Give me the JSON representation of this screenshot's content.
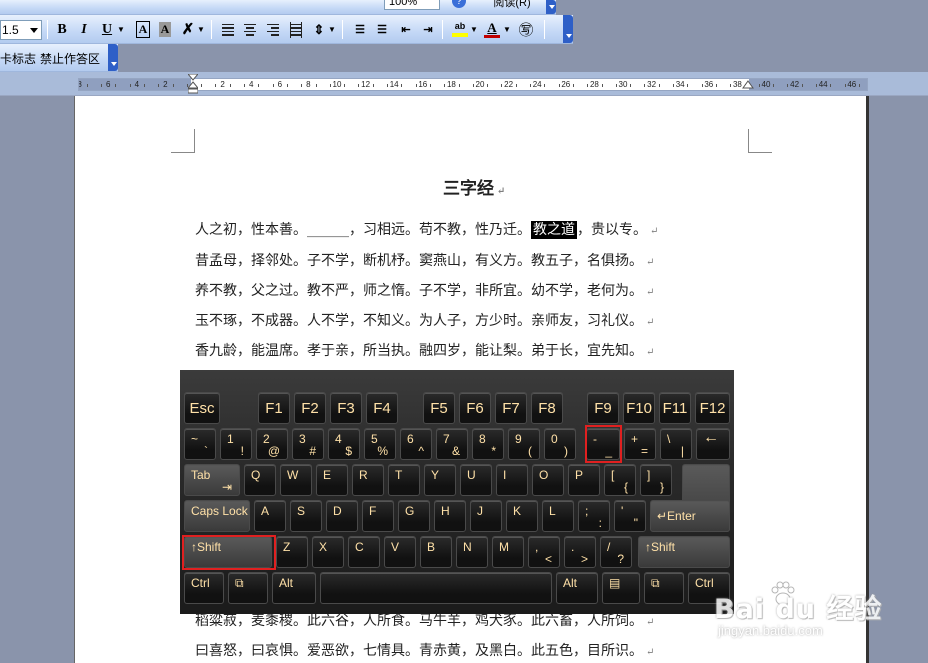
{
  "toolbar_top": {
    "zoom_value": "100%",
    "read_label": "阅读(R)"
  },
  "toolbar_format": {
    "line_spacing_value": "1.5",
    "bold_label": "B",
    "italic_label": "I",
    "underline_label": "U",
    "char_border_label": "A",
    "char_shading_label": "A",
    "font_color_label": "A",
    "highlight_label": "ab"
  },
  "toolbar_small": {
    "item1": "卡标志",
    "item2": "禁止作答区"
  },
  "ruler": {
    "left_numbers": [
      "8",
      "6",
      "4",
      "2"
    ],
    "right_numbers": [
      "2",
      "4",
      "6",
      "8",
      "10",
      "12",
      "14",
      "16",
      "18",
      "20",
      "22",
      "24",
      "26",
      "28",
      "30",
      "32",
      "34",
      "36",
      "38",
      "40",
      "42",
      "44",
      "46",
      "48"
    ]
  },
  "document": {
    "title": "三字经",
    "lines": [
      [
        "人之初，性本善。______，习相远。苟不教，性乃迁。",
        "教之道",
        "，贵以专。"
      ],
      [
        "昔孟母，择邻处。子不学，断机杼。窦燕山，有义方。教五子，名俱扬。"
      ],
      [
        "养不教，父之过。教不严，师之惰。子不学，非所宜。幼不学，老何为。"
      ],
      [
        "玉不琢，不成器。人不学，不知义。为人子，方少时。亲师友，习礼仪。"
      ],
      [
        "香九龄，能温席。孝于亲，所当执。融四岁，能让梨。弟于长，宜先知。"
      ],
      [
        "稻粱菽，麦黍稷。此六谷，人所食。马牛羊，鸡犬豕。此六畜，人所饲。"
      ],
      [
        "曰喜怒，曰哀惧。爱恶欲，七情具。青赤黄，及黑白。此五色，目所识。"
      ]
    ],
    "paragraph_mark": "↵"
  },
  "keyboard": {
    "row_f": [
      "Esc",
      "F1",
      "F2",
      "F3",
      "F4",
      "F5",
      "F6",
      "F7",
      "F8",
      "F9",
      "F10",
      "F11",
      "F12"
    ],
    "row_num": [
      {
        "top": "~",
        "bottom": "`"
      },
      {
        "top": "1",
        "bottom": "!"
      },
      {
        "top": "2",
        "bottom": "@"
      },
      {
        "top": "3",
        "bottom": "#"
      },
      {
        "top": "4",
        "bottom": "$"
      },
      {
        "top": "5",
        "bottom": "%"
      },
      {
        "top": "6",
        "bottom": "^"
      },
      {
        "top": "7",
        "bottom": "&"
      },
      {
        "top": "8",
        "bottom": "*"
      },
      {
        "top": "9",
        "bottom": "("
      },
      {
        "top": "0",
        "bottom": ")"
      },
      {
        "top": "-",
        "bottom": "_"
      },
      {
        "top": "+",
        "bottom": "="
      },
      {
        "top": "\\",
        "bottom": "|"
      },
      {
        "top": "←",
        "bottom": ""
      }
    ],
    "tab": "Tab",
    "row_q": [
      "Q",
      "W",
      "E",
      "R",
      "T",
      "Y",
      "U",
      "I",
      "O",
      "P"
    ],
    "bracket_l": {
      "top": "[",
      "bottom": "{"
    },
    "bracket_r": {
      "top": "]",
      "bottom": "}"
    },
    "caps": "Caps Lock",
    "row_a": [
      "A",
      "S",
      "D",
      "F",
      "G",
      "H",
      "J",
      "K",
      "L"
    ],
    "semicolon": {
      "top": ";",
      "bottom": ":"
    },
    "quote": {
      "top": "'",
      "bottom": "\""
    },
    "enter": "↵Enter",
    "shift_left": "↑Shift",
    "row_z": [
      "Z",
      "X",
      "C",
      "V",
      "B",
      "N",
      "M"
    ],
    "comma": {
      "top": ",",
      "bottom": "<"
    },
    "period": {
      "top": ".",
      "bottom": ">"
    },
    "slash": {
      "top": "/",
      "bottom": "?"
    },
    "shift_right": "↑Shift",
    "ctrl_left": "Ctrl",
    "alt_left": "Alt",
    "alt_right": "Alt",
    "ctrl_right": "Ctrl"
  },
  "watermark": {
    "brand": "Bai du 经验",
    "sub": "jingyan.baidu.com"
  },
  "colors": {
    "highlight_red": "#e02020",
    "toolbar_blue": "#2e5fc7",
    "key_text": "#ffe1a8"
  }
}
